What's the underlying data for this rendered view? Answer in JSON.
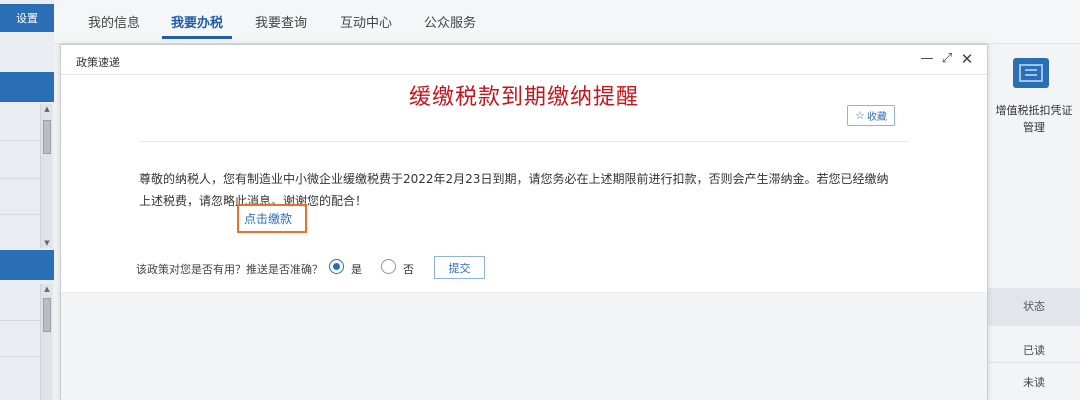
{
  "sidebar": {
    "settings_label": "设置"
  },
  "top_nav": {
    "items": [
      {
        "label": "我的信息"
      },
      {
        "label": "我要办税"
      },
      {
        "label": "我要查询"
      },
      {
        "label": "互动中心"
      },
      {
        "label": "公众服务"
      }
    ],
    "active": "我要办税"
  },
  "right_panel": {
    "vat_label_line1": "增值税抵扣凭证",
    "vat_label_line2": "管理",
    "status_header": "状态",
    "status_rows": [
      "已读",
      "未读"
    ]
  },
  "modal": {
    "title": "政策速递",
    "controls": {
      "minimize": "—",
      "maximize": "⤢",
      "close": "✕"
    },
    "notice_title": "缓缴税款到期缴纳提醒",
    "favorite_label": "收藏",
    "message_line1": "尊敬的纳税人，您有制造业中小微企业缓缴税费于2022年2月23日到期，请您务必在上述期限前进行扣款，否则会产生滞纳金。若您已经缴纳",
    "message_line2": "上述税费，请忽略此消息。谢谢您的配合！",
    "pay_link": "点击缴款",
    "survey": {
      "question": "该政策对您是否有用？推送是否准确？",
      "option_yes": "是",
      "option_no": "否",
      "selected": "是",
      "submit_label": "提交"
    }
  },
  "colors": {
    "brand_blue": "#2a6fb6",
    "title_red": "#c6161c",
    "highlight_orange": "#e8722b"
  }
}
